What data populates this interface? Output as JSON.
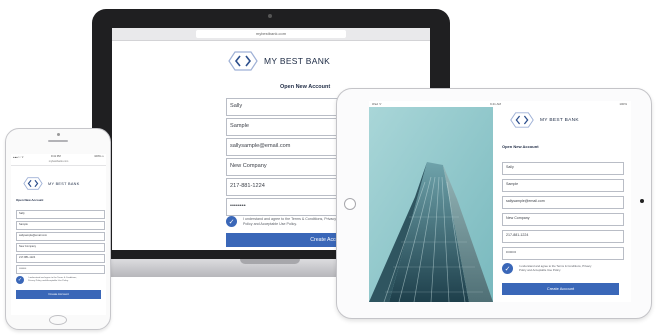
{
  "laptop": {
    "url": "mybestbank.com",
    "brand": "MY BEST BANK",
    "form_title": "Open New Account",
    "fields": [
      "Sally",
      "Sample",
      "sallysample@email.com",
      "New Company",
      "217-881-1224",
      "••••••••"
    ],
    "agree_text": "I understand and agree to the Terms & Conditions, Privacy Policy and Acceptable Use Policy.",
    "button": "Create Account"
  },
  "tablet": {
    "status_left": "iPad ᯤ",
    "status_time": "9:41 AM",
    "status_right": "100%",
    "brand": "MY BEST BANK",
    "form_title": "Open New Account",
    "fields": [
      "Sally",
      "Sample",
      "sallysample@email.com",
      "New Company",
      "217-881-1224",
      "••••••••"
    ],
    "agree_text": "I understand and agree to the Terms & Conditions, Privacy Policy and Acceptable Use Policy.",
    "button": "Create Account"
  },
  "phone": {
    "status_left": "●●●○○ ᯤ",
    "status_time": "9:41 PM",
    "status_right": "100% ▭",
    "url": "mybestbank.com",
    "brand": "MY BEST BANK",
    "form_title": "Open New Account",
    "fields": [
      "Sally",
      "Sample",
      "sallysample@email.com",
      "New Company",
      "217-881-1224",
      "••••••••"
    ],
    "agree_text": "I understand and agree to the Terms & Conditions, Privacy Policy and Acceptable Use Policy.",
    "button": "Create Account"
  },
  "colors": {
    "accent": "#3a67b8",
    "brand_text": "#1c2a44",
    "logo_stroke": "#2c4e8c"
  }
}
